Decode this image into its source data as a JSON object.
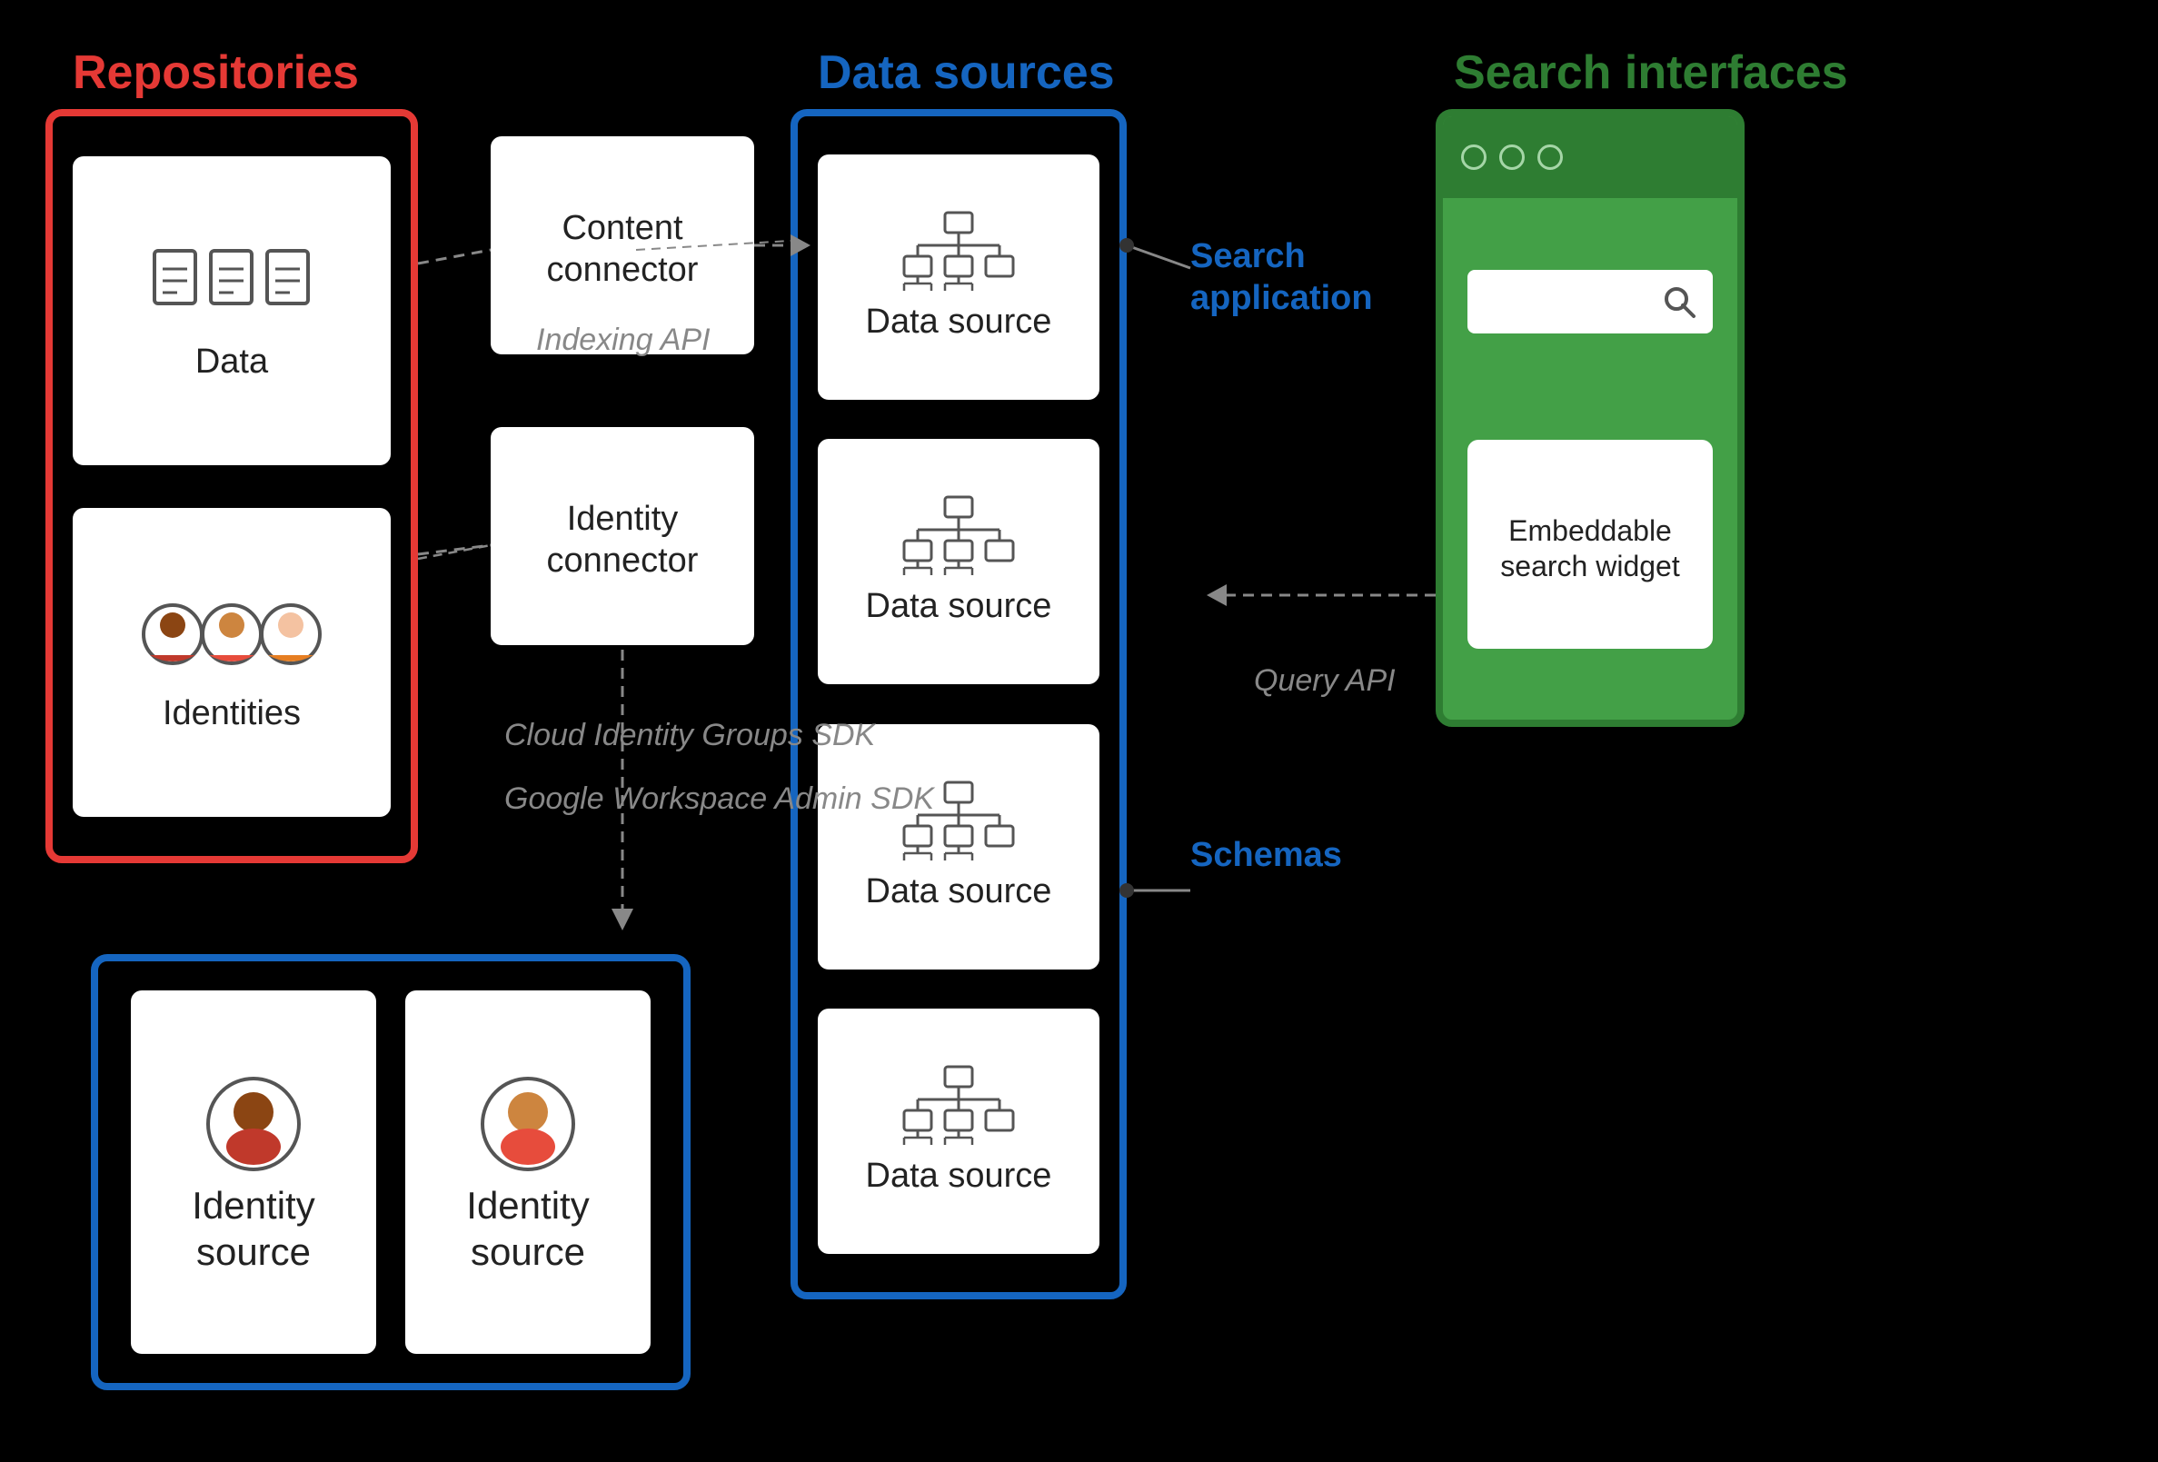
{
  "labels": {
    "repositories": "Repositories",
    "data_sources": "Data sources",
    "search_interfaces": "Search interfaces"
  },
  "repositories": {
    "data_label": "Data",
    "identities_label": "Identities"
  },
  "connectors": {
    "content_connector": "Content connector",
    "identity_connector": "Identity connector"
  },
  "data_sources": {
    "items": [
      {
        "label": "Data source"
      },
      {
        "label": "Data source"
      },
      {
        "label": "Data source"
      },
      {
        "label": "Data source"
      }
    ]
  },
  "search_interfaces": {
    "search_label": "Search",
    "embeddable_label": "Embeddable search widget"
  },
  "identity_sources": {
    "source1": "Identity source",
    "source2": "Identity source"
  },
  "arrow_labels": {
    "indexing_api": "Indexing API",
    "cloud_identity": "Cloud Identity Groups SDK",
    "google_workspace": "Google Workspace Admin SDK",
    "query_api": "Query API",
    "search_application": "Search application",
    "schemas": "Schemas"
  }
}
